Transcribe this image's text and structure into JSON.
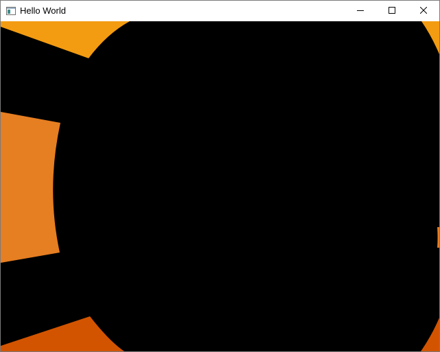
{
  "window": {
    "title": "Hello World",
    "icons": {
      "app": "app-window-icon",
      "minimize": "minimize-icon",
      "maximize": "maximize-icon",
      "close": "close-icon"
    }
  },
  "canvas": {
    "background": "#000000",
    "colors": {
      "top_left_wedge": "#f39c12",
      "left_wedge": "#e67e22",
      "bottom_left_wedge": "#d35400",
      "right_edge_top": "#f39c12",
      "right_edge_mid": "#e67e22",
      "right_edge_bottom": "#d35400"
    }
  }
}
